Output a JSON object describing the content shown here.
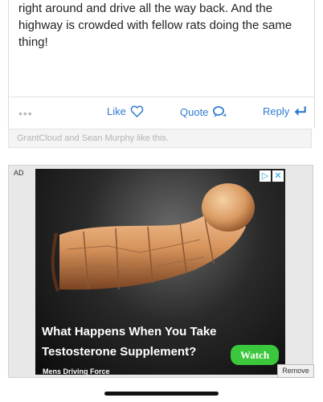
{
  "post": {
    "text_line1": "right around and drive all the way back. And the",
    "text_line2": "highway is crowded with fellow rats doing the same",
    "text_line3": "thing!"
  },
  "actions": {
    "more": "•••",
    "like_label": "Like",
    "like_icon": "heart-outline-icon",
    "quote_label": "Quote",
    "quote_icon": "speech-bubbles-icon",
    "reply_label": "Reply",
    "reply_icon": "reply-arrow-icon",
    "accent_color": "#2f7bd1"
  },
  "likes_line": "GrantCloud and Sean Murphy like this.",
  "ad": {
    "tag": "AD",
    "adchoices_play": "▷",
    "adchoices_close": "✕",
    "headline_line1": "What Happens When You Take",
    "headline_line2": "Testosterone Supplement?",
    "watch_label": "Watch",
    "advertiser": "Mens Driving Force",
    "remove_label": "Remove"
  }
}
